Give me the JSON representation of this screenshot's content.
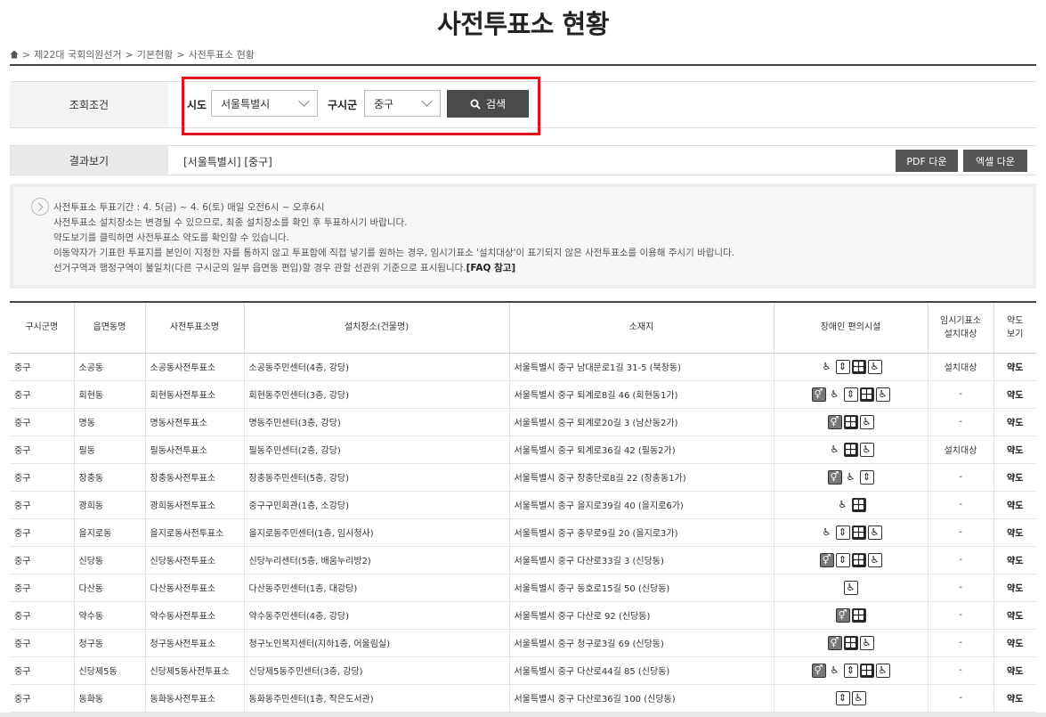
{
  "page": {
    "title": "사전투표소 현황"
  },
  "breadcrumb": {
    "items": [
      "제22대 국회의원선거",
      "기본현황",
      "사전투표소 현황"
    ]
  },
  "search": {
    "condition_label": "조회조건",
    "sido_label": "시도",
    "sido_value": "서울특별시",
    "sigungu_label": "구시군",
    "sigungu_value": "중구",
    "search_button": "검색"
  },
  "result": {
    "label": "결과보기",
    "value": "[서울특별시] [중구]",
    "pdf_button": "PDF 다운",
    "excel_button": "엑셀 다운"
  },
  "notice": {
    "lines": [
      "사전투표소 투표기간 : 4. 5(금) ~ 4. 6(토) 매일 오전6시 ~ 오후6시",
      "사전투표소 설치장소는 변경될 수 있으므로, 최종 설치장소를 확인 후 투표하시기 바랍니다.",
      "약도보기를 클릭하면 사전투표소 약도를 확인할 수 있습니다.",
      "이동약자가 기표한 투표지를 본인이 지정한 자를 통하지 않고 투표함에 직접 넣기를 원하는 경우, 임시기표소 '설치대상'이 표기되지 않은 사전투표소를 이용해 주시기 바랍니다.",
      "선거구역과 행정구역이 불일치(다른 구시군의 일부 읍면동 편입)할 경우 관할 선관위 기준으로 표시됩니다."
    ],
    "faq_link": "[FAQ 참고]"
  },
  "table": {
    "headers": [
      "구시군명",
      "읍면동명",
      "사전투표소명",
      "설치장소(건물명)",
      "소재지",
      "장애인 편의시설",
      "임시기표소\n설치대상",
      "약도\n보기"
    ],
    "rows": [
      {
        "gu": "중구",
        "dong": "소공동",
        "name": "소공동사전투표소",
        "place": "소공동주민센터(4층, 강당)",
        "addr": "서울특별시 중구 남대문로1길 31-5 (북창동)",
        "icons": [
          "wheelchair",
          "elevator",
          "braille",
          "ramp"
        ],
        "temp": "설치대상",
        "map": "약도"
      },
      {
        "gu": "중구",
        "dong": "회현동",
        "name": "회현동사전투표소",
        "place": "회현동주민센터(3층, 강당)",
        "addr": "서울특별시 중구 퇴계로8길 46 (회현동1가)",
        "icons": [
          "restroom",
          "wheelchair",
          "elevator",
          "braille",
          "ramp"
        ],
        "temp": "-",
        "map": "약도"
      },
      {
        "gu": "중구",
        "dong": "명동",
        "name": "명동사전투표소",
        "place": "명동주민센터(3층, 강당)",
        "addr": "서울특별시 중구 퇴계로20길 3 (남산동2가)",
        "icons": [
          "restroom",
          "braille",
          "ramp"
        ],
        "temp": "-",
        "map": "약도"
      },
      {
        "gu": "중구",
        "dong": "필동",
        "name": "필동사전투표소",
        "place": "필동주민센터(2층, 강당)",
        "addr": "서울특별시 중구 퇴계로36길 42 (필동2가)",
        "icons": [
          "wheelchair",
          "braille",
          "ramp"
        ],
        "temp": "설치대상",
        "map": "약도"
      },
      {
        "gu": "중구",
        "dong": "장충동",
        "name": "장충동사전투표소",
        "place": "장충동주민센터(5층, 강당)",
        "addr": "서울특별시 중구 장충단로8길 22 (장충동1가)",
        "icons": [
          "restroom",
          "wheelchair",
          "elevator"
        ],
        "temp": "-",
        "map": "약도"
      },
      {
        "gu": "중구",
        "dong": "광희동",
        "name": "광희동사전투표소",
        "place": "중구구민회관(1층, 소강당)",
        "addr": "서울특별시 중구 을지로39길 40 (을지로6가)",
        "icons": [
          "wheelchair",
          "braille"
        ],
        "temp": "-",
        "map": "약도"
      },
      {
        "gu": "중구",
        "dong": "을지로동",
        "name": "을지로동사전투표소",
        "place": "을지로동주민센터(1층, 임시청사)",
        "addr": "서울특별시 중구 충무로9길 20 (을지로3가)",
        "icons": [
          "wheelchair",
          "elevator",
          "braille",
          "ramp"
        ],
        "temp": "-",
        "map": "약도"
      },
      {
        "gu": "중구",
        "dong": "신당동",
        "name": "신당동사전투표소",
        "place": "신당누리센터(5층, 배움누리방2)",
        "addr": "서울특별시 중구 다산로33길 3 (신당동)",
        "icons": [
          "restroom",
          "elevator",
          "braille",
          "ramp"
        ],
        "temp": "-",
        "map": "약도"
      },
      {
        "gu": "중구",
        "dong": "다산동",
        "name": "다산동사전투표소",
        "place": "다산동주민센터(1층, 대강당)",
        "addr": "서울특별시 중구 동호로15길 50 (신당동)",
        "icons": [
          "ramp"
        ],
        "temp": "-",
        "map": "약도"
      },
      {
        "gu": "중구",
        "dong": "약수동",
        "name": "약수동사전투표소",
        "place": "약수동주민센터(4층, 강당)",
        "addr": "서울특별시 중구 다산로 92 (신당동)",
        "icons": [
          "restroom",
          "braille"
        ],
        "temp": "-",
        "map": "약도"
      },
      {
        "gu": "중구",
        "dong": "청구동",
        "name": "청구동사전투표소",
        "place": "청구노인복지센터(지하1층, 어울림실)",
        "addr": "서울특별시 중구 청구로3길 69 (신당동)",
        "icons": [
          "restroom",
          "braille",
          "ramp"
        ],
        "temp": "-",
        "map": "약도"
      },
      {
        "gu": "중구",
        "dong": "신당제5동",
        "name": "신당제5동사전투표소",
        "place": "신당제5동주민센터(3층, 강당)",
        "addr": "서울특별시 중구 다산로44길 85 (신당동)",
        "icons": [
          "restroom",
          "wheelchair",
          "elevator",
          "braille",
          "ramp"
        ],
        "temp": "-",
        "map": "약도"
      },
      {
        "gu": "중구",
        "dong": "동화동",
        "name": "동화동사전투표소",
        "place": "동화동주민센터(1층, 작은도서관)",
        "addr": "서울특별시 중구 다산로36길 100 (신당동)",
        "icons": [
          "elevator",
          "ramp"
        ],
        "temp": "-",
        "map": "약도"
      }
    ]
  }
}
